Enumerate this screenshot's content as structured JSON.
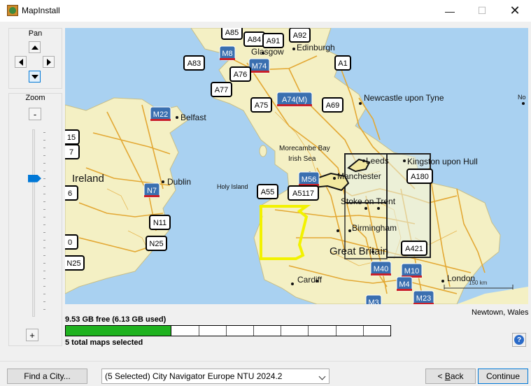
{
  "window": {
    "title": "MapInstall",
    "min_glyph": "—",
    "max_glyph": "☐",
    "close_glyph": "✕"
  },
  "pan": {
    "label": "Pan"
  },
  "zoom": {
    "label": "Zoom",
    "minus_label": "-",
    "plus_label": "+",
    "level_fraction": 0.26
  },
  "map": {
    "cities": [
      {
        "name": "Glasgow",
        "big": false
      },
      {
        "name": "Edinburgh",
        "big": false
      },
      {
        "name": "Newcastle upon Tyne",
        "big": false
      },
      {
        "name": "Belfast",
        "big": false
      },
      {
        "name": "Morecambe Bay",
        "big": false,
        "small": true
      },
      {
        "name": "Irish Sea",
        "big": false,
        "small": true
      },
      {
        "name": "Leeds",
        "big": false
      },
      {
        "name": "Kingston upon Hull",
        "big": false
      },
      {
        "name": "Ireland",
        "big": true
      },
      {
        "name": "Dublin",
        "big": false
      },
      {
        "name": "Holy Island",
        "big": false,
        "small": true
      },
      {
        "name": "Manchester",
        "big": false
      },
      {
        "name": "Stoke on Trent",
        "big": false
      },
      {
        "name": "Birmingham",
        "big": false
      },
      {
        "name": "Great Britain",
        "big": true
      },
      {
        "name": "Cardiff",
        "big": false
      },
      {
        "name": "London",
        "big": false
      },
      {
        "name": "No",
        "big": false,
        "small": true
      }
    ],
    "shields": [
      {
        "label": "A85",
        "kind": "a"
      },
      {
        "label": "A84",
        "kind": "a"
      },
      {
        "label": "A91",
        "kind": "a"
      },
      {
        "label": "A92",
        "kind": "a"
      },
      {
        "label": "M8",
        "kind": "m"
      },
      {
        "label": "A83",
        "kind": "a"
      },
      {
        "label": "M74",
        "kind": "m"
      },
      {
        "label": "A1",
        "kind": "a"
      },
      {
        "label": "A76",
        "kind": "a"
      },
      {
        "label": "A77",
        "kind": "a"
      },
      {
        "label": "A74(M)",
        "kind": "m"
      },
      {
        "label": "A75",
        "kind": "a"
      },
      {
        "label": "A69",
        "kind": "a"
      },
      {
        "label": "M22",
        "kind": "m"
      },
      {
        "label": "15",
        "kind": "a"
      },
      {
        "label": "7",
        "kind": "a"
      },
      {
        "label": "A180",
        "kind": "a"
      },
      {
        "label": "M56",
        "kind": "m"
      },
      {
        "label": "A55",
        "kind": "a"
      },
      {
        "label": "A5117",
        "kind": "a"
      },
      {
        "label": "N7",
        "kind": "m"
      },
      {
        "label": "6",
        "kind": "a"
      },
      {
        "label": "N11",
        "kind": "a"
      },
      {
        "label": "N25",
        "kind": "a"
      },
      {
        "label": "0",
        "kind": "a"
      },
      {
        "label": "N25",
        "kind": "a"
      },
      {
        "label": "A421",
        "kind": "a"
      },
      {
        "label": "M40",
        "kind": "m"
      },
      {
        "label": "M10",
        "kind": "m"
      },
      {
        "label": "M4",
        "kind": "m"
      },
      {
        "label": "M23",
        "kind": "m"
      },
      {
        "label": "M3",
        "kind": "m"
      }
    ],
    "scale_label": "150 km"
  },
  "status": {
    "location": "Newtown, Wales",
    "free_text": "9.53 GB free (6.13 GB used)",
    "used_fraction": 0.325,
    "total_text": "5 total maps selected"
  },
  "footer": {
    "find_city": "Find a City...",
    "map_select": "(5 Selected) City Navigator Europe NTU 2024.2",
    "back_prefix": "< ",
    "back_key": "B",
    "back_rest": "ack",
    "continue": "Continue"
  },
  "colors": {
    "land": "#f4f0c4",
    "sea": "#a9d1f1",
    "road": "#e3a834",
    "selection": "#f2f200",
    "usage": "#1fb21f",
    "accent": "#0078d7"
  },
  "icons": {
    "help": "?"
  }
}
